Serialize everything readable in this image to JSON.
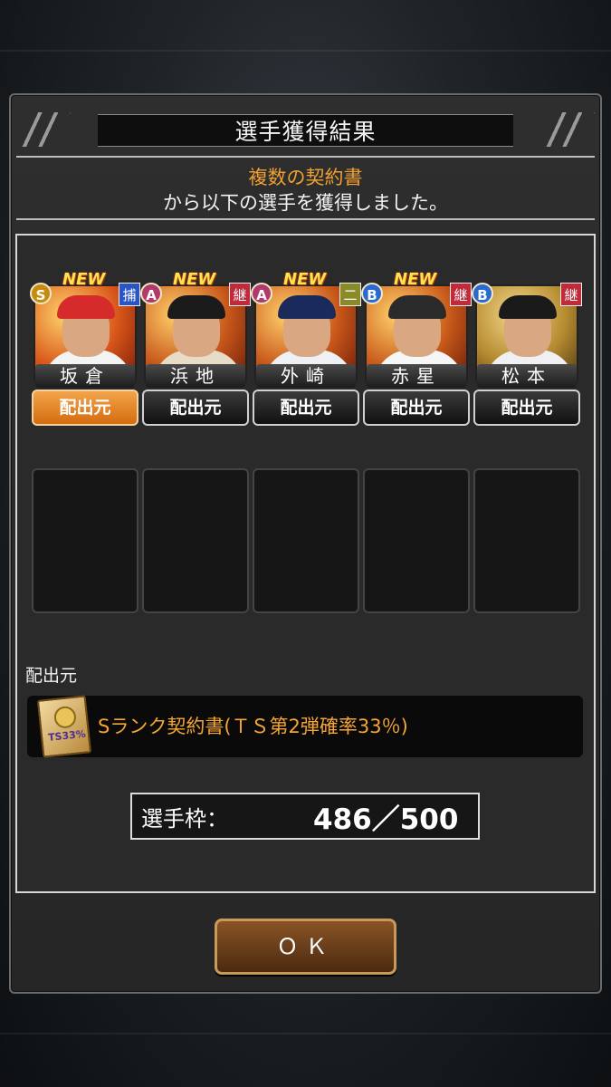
{
  "dialog": {
    "title": "選手獲得結果",
    "source_name": "複数の契約書",
    "message": "から以下の選手を獲得しました。"
  },
  "players": [
    {
      "new_label": "NEW",
      "rank": "S",
      "rank_color": "#c58a10",
      "position": "捕",
      "position_color": "#2a55c4",
      "name": "坂倉",
      "source_button": "配出元",
      "active": true,
      "theme": "#d52b2b"
    },
    {
      "new_label": "NEW",
      "rank": "A",
      "rank_color": "#b03a6a",
      "position": "継",
      "position_color": "#c02a3a",
      "name": "浜地",
      "source_button": "配出元",
      "active": false,
      "theme": "#d9c7a8"
    },
    {
      "new_label": "NEW",
      "rank": "A",
      "rank_color": "#b03a6a",
      "position": "二",
      "position_color": "#8a8a28",
      "name": "外崎",
      "source_button": "配出元",
      "active": false,
      "theme": "#e6e6ea"
    },
    {
      "new_label": "NEW",
      "rank": "B",
      "rank_color": "#2a6ad0",
      "position": "継",
      "position_color": "#c02a3a",
      "name": "赤星",
      "source_button": "配出元",
      "active": false,
      "theme": "#f2f2f2"
    },
    {
      "new_label": "",
      "rank": "B",
      "rank_color": "#2a6ad0",
      "position": "継",
      "position_color": "#c02a3a",
      "name": "松本",
      "source_button": "配出元",
      "active": false,
      "theme": "#efeff2"
    }
  ],
  "source_section": {
    "label": "配出元",
    "item_text": "Sランク契約書(ＴＳ第2弾確率33％)",
    "ticket_text": "TS33%"
  },
  "roster": {
    "label": "選手枠：",
    "value": "486／500"
  },
  "ok_button": "ＯＫ"
}
